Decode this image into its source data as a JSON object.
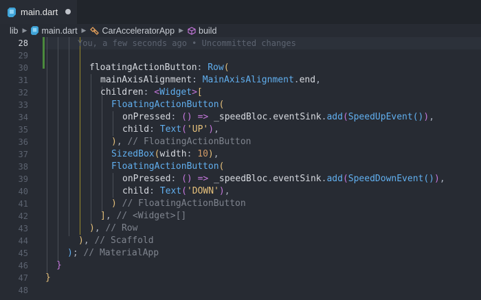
{
  "tab": {
    "file_name": "main.dart"
  },
  "breadcrumb": {
    "items": [
      "lib",
      "main.dart",
      "CarAcceleratorApp",
      "build"
    ]
  },
  "editor": {
    "current_line": "28",
    "line_numbers": [
      "28",
      "29",
      "30",
      "31",
      "32",
      "33",
      "34",
      "35",
      "36",
      "37",
      "38",
      "39",
      "40",
      "41",
      "42",
      "43",
      "44",
      "45",
      "46",
      "47",
      "48"
    ],
    "blame": "You, a few seconds ago • Uncommitted changes",
    "lines": {
      "l30": [
        "floatingActionButton",
        ": ",
        "Row",
        "("
      ],
      "l31": [
        "mainAxisAlignment",
        ": ",
        "MainAxisAlignment",
        ".",
        "end",
        ","
      ],
      "l32": [
        "children",
        ": ",
        "<",
        "Widget",
        ">",
        "["
      ],
      "l33": [
        "FloatingActionButton",
        "("
      ],
      "l34": [
        "onPressed",
        ": ",
        "()",
        " => ",
        "_speedBloc",
        ".",
        "eventSink",
        ".",
        "add",
        "(",
        "SpeedUpEvent",
        "()",
        ")",
        ","
      ],
      "l35": [
        "child",
        ": ",
        "Text",
        "(",
        "'UP'",
        ")",
        ","
      ],
      "l36": [
        ")",
        ", ",
        "// FloatingActionButton"
      ],
      "l37": [
        "SizedBox",
        "(",
        "width",
        ": ",
        "10",
        ")",
        ","
      ],
      "l38": [
        "FloatingActionButton",
        "("
      ],
      "l39": [
        "onPressed",
        ": ",
        "()",
        " => ",
        "_speedBloc",
        ".",
        "eventSink",
        ".",
        "add",
        "(",
        "SpeedDownEvent",
        "()",
        ")",
        ","
      ],
      "l40": [
        "child",
        ": ",
        "Text",
        "(",
        "'DOWN'",
        ")",
        ","
      ],
      "l41": [
        ")",
        " ",
        "// FloatingActionButton"
      ],
      "l42": [
        "]",
        ", ",
        "// <Widget>[]"
      ],
      "l43": [
        ")",
        ", ",
        "// Row"
      ],
      "l44": [
        ")",
        ", ",
        "// Scaffold"
      ],
      "l45": [
        ")",
        "; ",
        "// MaterialApp"
      ],
      "l46": [
        "}"
      ],
      "l47": [
        "}"
      ]
    }
  },
  "colors": {
    "background": "#272b33",
    "tabbar": "#21252b",
    "git_modified": "#4b8a3c",
    "keyword": "#c678dd",
    "class": "#61afef",
    "string": "#e5c07b",
    "comment": "#7f848e"
  },
  "icons": [
    "dart-file-icon",
    "class-icon",
    "method-cube-icon",
    "unsaved-dot-icon"
  ]
}
